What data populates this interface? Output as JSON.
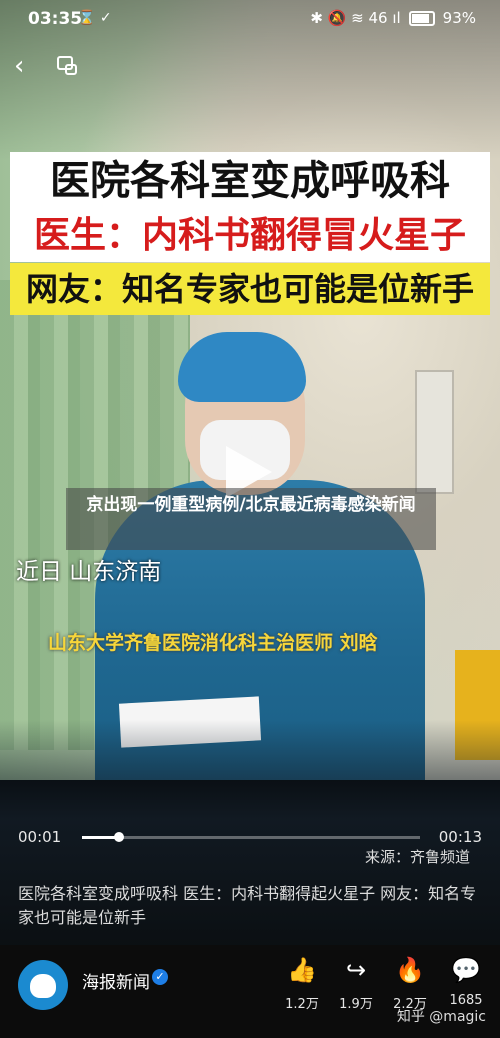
{
  "status_bar": {
    "time": "03:35",
    "left_icons": "⌛ ✓",
    "right_icons": "✱ 🔕 ≋ 46 ıl",
    "battery": "93%"
  },
  "video": {
    "caption_line1": "医院各科室变成呼吸科",
    "caption_line2_prefix": "医生：",
    "caption_line2_rest": "内科书翻得冒火星子",
    "caption_line3": "网友：知名专家也可能是位新手",
    "overlay_title": "京出现一例重型病例/北京最近病毒感染新闻",
    "location": "近日 山东济南",
    "doctor_label": "山东大学齐鲁医院消化科主治医师 刘晗"
  },
  "player": {
    "current_time": "00:01",
    "duration": "00:13",
    "progress": 0.11,
    "source": "来源：齐鲁频道"
  },
  "description": "医院各科室变成呼吸科 医生：内科书翻得起火星子 网友：知名专家也可能是位新手",
  "author": {
    "name": "海报新闻",
    "verified_mark": "✓"
  },
  "actions": [
    {
      "icon": "thumbs-up-icon",
      "glyph": "👍",
      "count": "1.2万"
    },
    {
      "icon": "share-icon",
      "glyph": "↪",
      "count": "1.9万"
    },
    {
      "icon": "flame-icon",
      "glyph": "🔥",
      "count": "2.2万"
    },
    {
      "icon": "comment-icon",
      "glyph": "💬",
      "count": "1685"
    }
  ],
  "watermark": "知乎 @magic"
}
